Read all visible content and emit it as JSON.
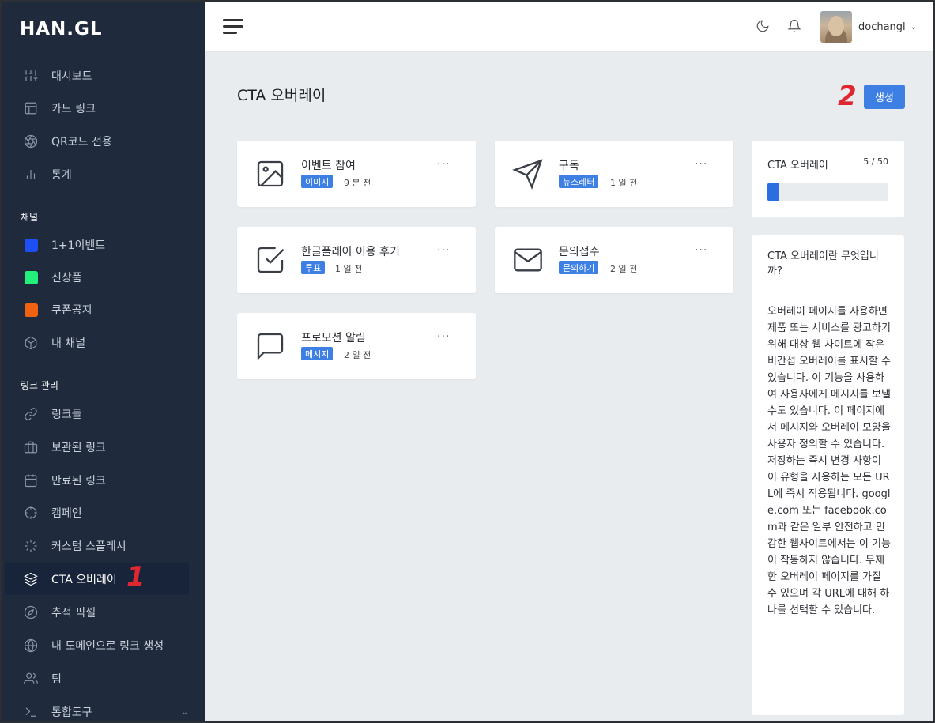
{
  "brand": {
    "logo": "HAN.GL"
  },
  "sidebar": {
    "items": [
      {
        "label": "대시보드",
        "icon": "sliders-icon"
      },
      {
        "label": "카드 링크",
        "icon": "layout-icon"
      },
      {
        "label": "QR코드 전용",
        "icon": "aperture-icon"
      },
      {
        "label": "통계",
        "icon": "bar-chart-icon"
      }
    ],
    "channels_title": "채널",
    "channels": [
      {
        "label": "1+1이벤트",
        "color": "#1d4ff5"
      },
      {
        "label": "신상품",
        "color": "#22f07a"
      },
      {
        "label": "쿠폰공지",
        "color": "#f0620f"
      },
      {
        "label": "내 채널",
        "icon": "box-icon"
      }
    ],
    "links_title": "링크 관리",
    "link_items": [
      {
        "label": "링크들",
        "icon": "link-icon"
      },
      {
        "label": "보관된 링크",
        "icon": "briefcase-icon"
      },
      {
        "label": "만료된 링크",
        "icon": "calendar-icon"
      },
      {
        "label": "캠페인",
        "icon": "crosshair-icon"
      },
      {
        "label": "커스텀 스플레시",
        "icon": "loader-icon"
      },
      {
        "label": "CTA 오버레이",
        "icon": "layers-icon",
        "active": true
      },
      {
        "label": "추적 픽셀",
        "icon": "compass-icon"
      },
      {
        "label": "내 도메인으로 링크 생성",
        "icon": "globe-icon"
      },
      {
        "label": "팀",
        "icon": "users-icon"
      },
      {
        "label": "통합도구",
        "icon": "terminal-icon"
      }
    ],
    "marker": "1"
  },
  "topbar": {
    "username": "dochangl"
  },
  "main": {
    "title": "CTA 오버레이",
    "marker": "2",
    "create_label": "생성",
    "cards": [
      {
        "title": "이벤트 참여",
        "badge": "이미지",
        "time": "9 분 전",
        "icon": "image-icon"
      },
      {
        "title": "구독",
        "badge": "뉴스레터",
        "time": "1 일 전",
        "icon": "send-icon"
      },
      {
        "title": "한글플레이 이용 후기",
        "badge": "투표",
        "time": "1 일 전",
        "icon": "check-square-icon"
      },
      {
        "title": "문의접수",
        "badge": "문의하기",
        "time": "2 일 전",
        "icon": "mail-icon"
      },
      {
        "title": "프로모션 알림",
        "badge": "메시지",
        "time": "2 일 전",
        "icon": "message-square-icon"
      }
    ],
    "more_label": "···",
    "stats": {
      "label": "CTA 오버레이",
      "count": "5 / 50",
      "progress": 0.1
    },
    "info": {
      "title": "CTA 오버레이란 무엇입니까?",
      "body": "오버레이 페이지를 사용하면 제품 또는 서비스를 광고하기 위해 대상 웹 사이트에 작은 비간섭 오버레이를 표시할 수 있습니다. 이 기능을 사용하여 사용자에게 메시지를 보낼 수도 있습니다. 이 페이지에서 메시지와 오버레이 모양을 사용자 정의할 수 있습니다. 저장하는 즉시 변경 사항이 이 유형을 사용하는 모든 URL에 즉시 적용됩니다. google.com 또는 facebook.com과 같은 일부 안전하고 민감한 웹사이트에서는 이 기능이 작동하지 않습니다. 무제한 오버레이 페이지를 가질 수 있으며 각 URL에 대해 하나를 선택할 수 있습니다."
    }
  }
}
